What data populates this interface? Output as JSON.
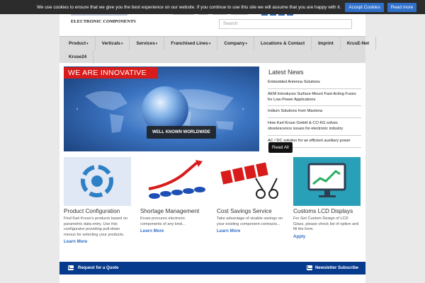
{
  "cookie": {
    "text": "We use cookies to ensure that we give you the best experience on our website. If you continue to use this site we will assume that you are happy with it.",
    "accept": "Accept Cookies",
    "more": "Read more"
  },
  "header": {
    "tagline": "ELECTRONIC COMPONENTS",
    "search_placeholder": "Search"
  },
  "nav": {
    "row1": [
      "Product",
      "Verticals",
      "Services",
      "Franchised Lines",
      "Company",
      "Locations & Contact",
      "Imprint",
      "KrusE-Net"
    ],
    "row1_dropdown": [
      true,
      true,
      true,
      true,
      true,
      false,
      false,
      false
    ],
    "row2": [
      "Kruse24"
    ]
  },
  "hero": {
    "banner": "WE ARE INNOVATIVE",
    "badge": "WELL KNOWN WORLDWIDE"
  },
  "news": {
    "title": "Latest News",
    "items": [
      "Embedded Antenna Solutions",
      "AEM Introduces Surface-Mount Fast-Acting Fuses for Low-Power Applications",
      "Iridium Solutions from Maxtena",
      "How Karl Kruse GmbH & CO KG solves obsolescence issues for electronic industry",
      "AC / DC solution for an efficient auxiliary power"
    ],
    "read_all": "Read All"
  },
  "cards": [
    {
      "title": "Product Configuration",
      "text": "Find Karl Kruse's products based on parametric data entry. Use this configurator providing pull-down menus for selecting your products.",
      "link": "Learn More"
    },
    {
      "title": "Shortage Management",
      "text": "Kruse procures electronic components of any kind...",
      "link": "Learn More"
    },
    {
      "title": "Cost Savings Service",
      "text": "Take advantage of sizable savings on your existing component contracts...",
      "link": "Learn More"
    },
    {
      "title": "Customs LCD Displays",
      "text": "For Get Custom Design of LCD Glass, please check list of option and fill the form.",
      "link": "Apply"
    }
  ],
  "footer": {
    "left": "Request for a Quote",
    "right": "Newsletter Subscribe"
  },
  "colors": {
    "accent": "#2f6fc9",
    "banner_red": "#d81b1b",
    "footer_blue": "#053a8c"
  }
}
